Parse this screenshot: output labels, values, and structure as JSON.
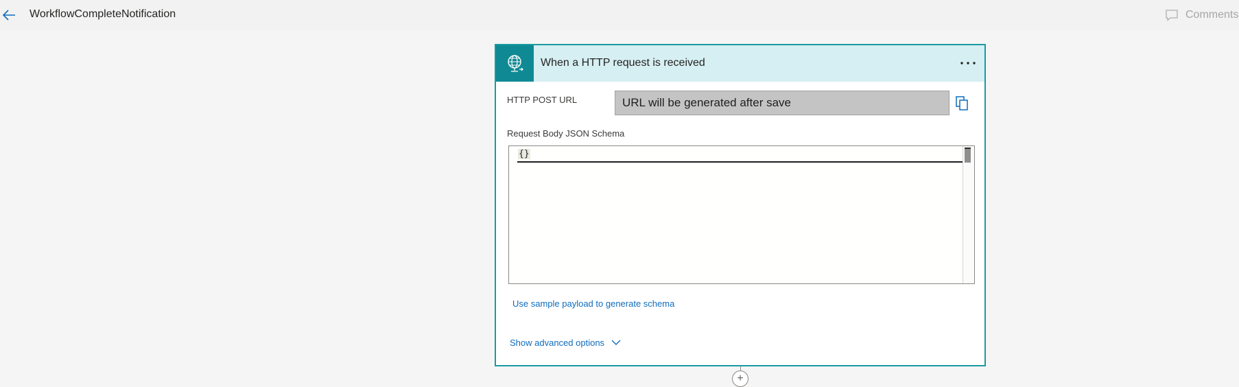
{
  "header": {
    "flow_title": "WorkflowCompleteNotification",
    "comments_label": "Comments"
  },
  "trigger_card": {
    "title": "When a HTTP request is received",
    "icon": "globe-request-icon",
    "more_label": "···",
    "http_post_url_label": "HTTP POST URL",
    "http_post_url_value": "URL will be generated after save",
    "schema_label": "Request Body JSON Schema",
    "schema_value": "{}",
    "sample_payload_link": "Use sample payload to generate schema",
    "advanced_options_label": "Show advanced options"
  },
  "add_step_label": "+",
  "colors": {
    "accent": "#0f8a94",
    "header_bg": "#d6eff2",
    "card_border": "#1a9aa0",
    "link": "#0f6cbd"
  }
}
